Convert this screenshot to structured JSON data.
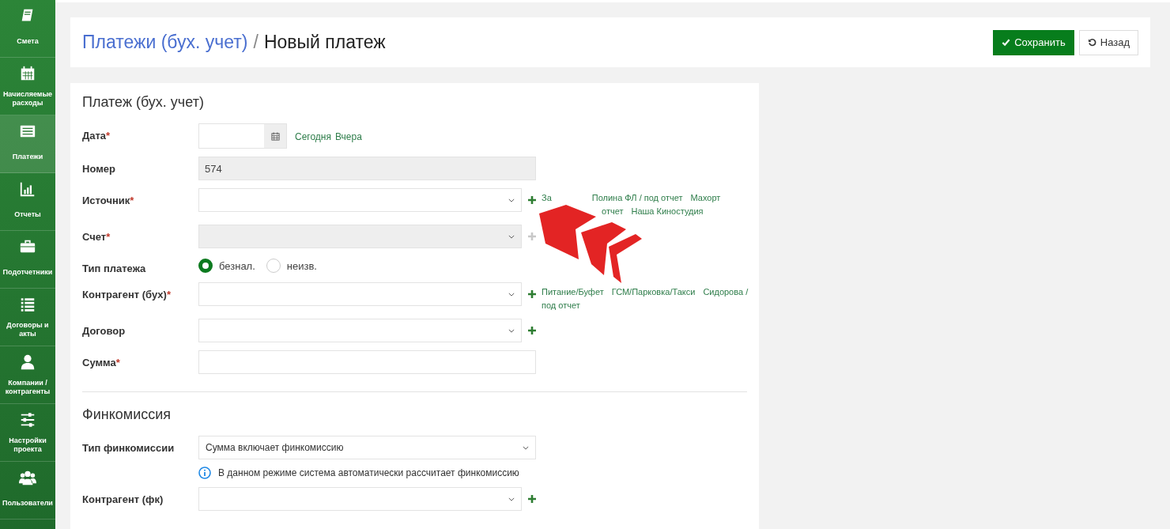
{
  "sidebar": {
    "items": [
      {
        "label": "Смета",
        "selected": false
      },
      {
        "label": "Начисляемые расходы",
        "selected": false
      },
      {
        "label": "Платежи",
        "selected": true
      },
      {
        "label": "Отчеты",
        "selected": false
      },
      {
        "label": "Подотчетники",
        "selected": false
      },
      {
        "label": "Договоры и акты",
        "selected": false
      },
      {
        "label": "Компании / контрагенты",
        "selected": false
      },
      {
        "label": "Настройки проекта",
        "selected": false
      },
      {
        "label": "Пользователи",
        "selected": false
      }
    ]
  },
  "header": {
    "breadcrumb": "Платежи (бух. учет)",
    "separator": "/",
    "title": "Новый платеж",
    "buttons": [
      {
        "label": "Сохранить",
        "kind": "primary"
      },
      {
        "label": "Назад",
        "kind": "back"
      }
    ]
  },
  "sections": [
    {
      "title": "Платеж (бух. учет)",
      "fields": [
        {
          "kind": "date",
          "label": "Дата",
          "required_mark": "*",
          "quick_links": [
            [
              "Сегодня",
              "Вчера"
            ]
          ]
        },
        {
          "kind": "text",
          "label": "Номер",
          "value": "574",
          "disabled": true
        },
        {
          "kind": "select",
          "label": "Источник",
          "required_mark": "*",
          "add": true,
          "quick_links": [
            [
              "За",
              "Полина ФЛ / под отчет",
              "Махорт"
            ],
            [
              "отчет",
              "Наша Киностудия"
            ]
          ]
        },
        {
          "kind": "select",
          "label": "Счет",
          "required_mark": "*",
          "disabled": true,
          "add": true
        },
        {
          "kind": "radio",
          "label": "Тип платежа",
          "options": [
            {
              "label": "безнал.",
              "selected": true
            },
            {
              "label": "неизв.",
              "selected": false
            }
          ]
        },
        {
          "kind": "select",
          "label": "Контрагент (бух)",
          "required_mark": "*",
          "add": true,
          "quick_links": [
            [
              "Питание/Буфет",
              "ГСМ/Парковка/Такси",
              "Сидорова /"
            ],
            [
              "под отчет"
            ]
          ]
        },
        {
          "kind": "select",
          "label": "Договор",
          "add": true
        },
        {
          "kind": "text",
          "label": "Сумма",
          "required_mark": "*"
        }
      ]
    },
    {
      "title": "Финкомиссия",
      "fields": [
        {
          "kind": "select",
          "label": "Тип финкомиссии",
          "value": "Сумма включает финкомиссию",
          "hint": "В данном режиме система автоматически рассчитает финкомиссию"
        },
        {
          "kind": "select",
          "label": "Контрагент (фк)",
          "add": true
        }
      ]
    }
  ]
}
